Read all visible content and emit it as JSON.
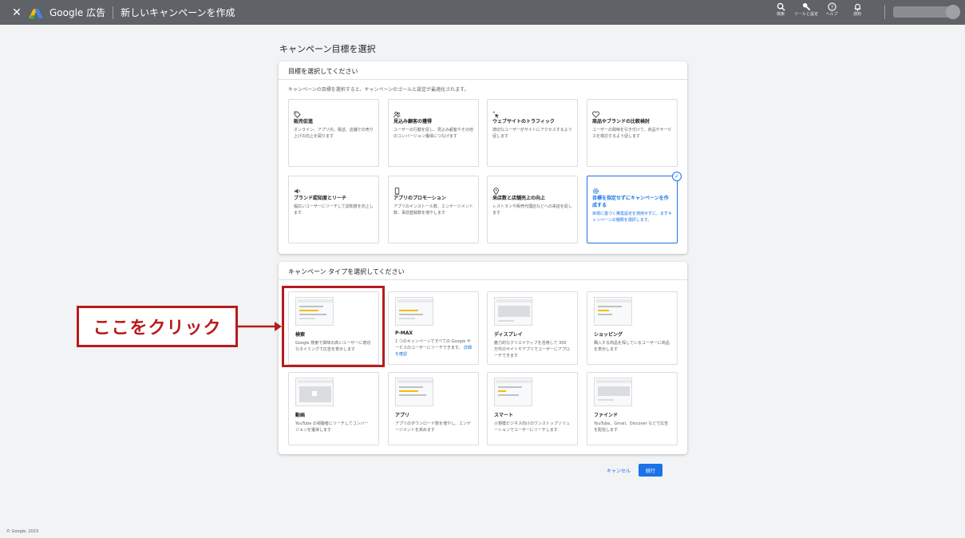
{
  "topbar": {
    "close": "✕",
    "brand": "Google 広告",
    "title": "新しいキャンペーンを作成",
    "tools": [
      {
        "icon": "search-icon",
        "label": "検索"
      },
      {
        "icon": "wrench-icon",
        "label": "ツールと設定"
      },
      {
        "icon": "help-icon",
        "label": "ヘルプ"
      },
      {
        "icon": "bell-icon",
        "label": "通知"
      }
    ]
  },
  "heading": "キャンペーン目標を選択",
  "goals": {
    "header": "目標を選択してください",
    "description": "キャンペーンの目標を選択すると、キャンペーンのゴールと設定が最適化されます。",
    "cards": [
      {
        "icon": "tag-icon",
        "title": "販売促進",
        "desc": "オンライン、アプリ内、電話、店舗での売り上げの向上を図ります"
      },
      {
        "icon": "people-icon",
        "title": "見込み顧客の獲得",
        "desc": "ユーザーの行動を促し、見込み顧客やその他のコンバージョン獲得につなげます"
      },
      {
        "icon": "cursor-click-icon",
        "title": "ウェブサイトのトラフィック",
        "desc": "適切なユーザーがサイトにアクセスするよう促します"
      },
      {
        "icon": "heart-icon",
        "title": "商品やブランドの比較検討",
        "desc": "ユーザーの興味を引き付けて、商品やサービスを検討するよう促します"
      },
      {
        "icon": "speaker-icon",
        "title": "ブランド認知度とリーチ",
        "desc": "幅広いユーザーにリーチして認知度を向上します"
      },
      {
        "icon": "phone-icon",
        "title": "アプリのプロモーション",
        "desc": "アプリのインストール数、エンゲージメント数、事前登録数を増やします"
      },
      {
        "icon": "location-pin-icon",
        "title": "来店数と店舗売上の向上",
        "desc": "レストランや販売代理店などへの来店を促します"
      },
      {
        "icon": "gear-icon",
        "title": "目標を指定せずにキャンペーンを作成する",
        "desc": "目標に基づく推奨設定を適用せずに、まずキャンペーンの種類を選択します。"
      }
    ],
    "selected_check": "✓"
  },
  "types": {
    "header": "キャンペーン タイプを選択してください",
    "cards": [
      {
        "title": "検索",
        "desc": "Google 検索で興味の高いユーザーに適切なタイミングで広告を表示します"
      },
      {
        "title": "P-MAX",
        "desc": "1 つのキャンペーンですべての Google サービスのユーザーにリーチできます。",
        "link": "詳細を確認"
      },
      {
        "title": "ディスプレイ",
        "desc": "魅力的なクリエイティブを活用して 300 万件のサイトやアプリでユーザーにアプローチできます"
      },
      {
        "title": "ショッピング",
        "desc": "購入する商品を探しているユーザーに商品を表示します"
      },
      {
        "title": "動画",
        "desc": "YouTube の視聴者にリーチしてコンバージョンを獲得します"
      },
      {
        "title": "アプリ",
        "desc": "アプリのダウンロード数を増やし、エンゲージメントを高めます"
      },
      {
        "title": "スマート",
        "desc": "小規模ビジネス向けのワンストップソリューションでユーザーにリーチします"
      },
      {
        "title": "ファインド",
        "desc": "YouTube、Gmail、Discover などで広告を配信します"
      }
    ]
  },
  "callout": "ここをクリック",
  "buttons": {
    "cancel": "キャンセル",
    "next": "続行"
  },
  "copyright": "© Google, 2023",
  "colors": {
    "topbar": "#5f6368",
    "accent": "#1a73e8",
    "annotation": "#b71c1c"
  }
}
